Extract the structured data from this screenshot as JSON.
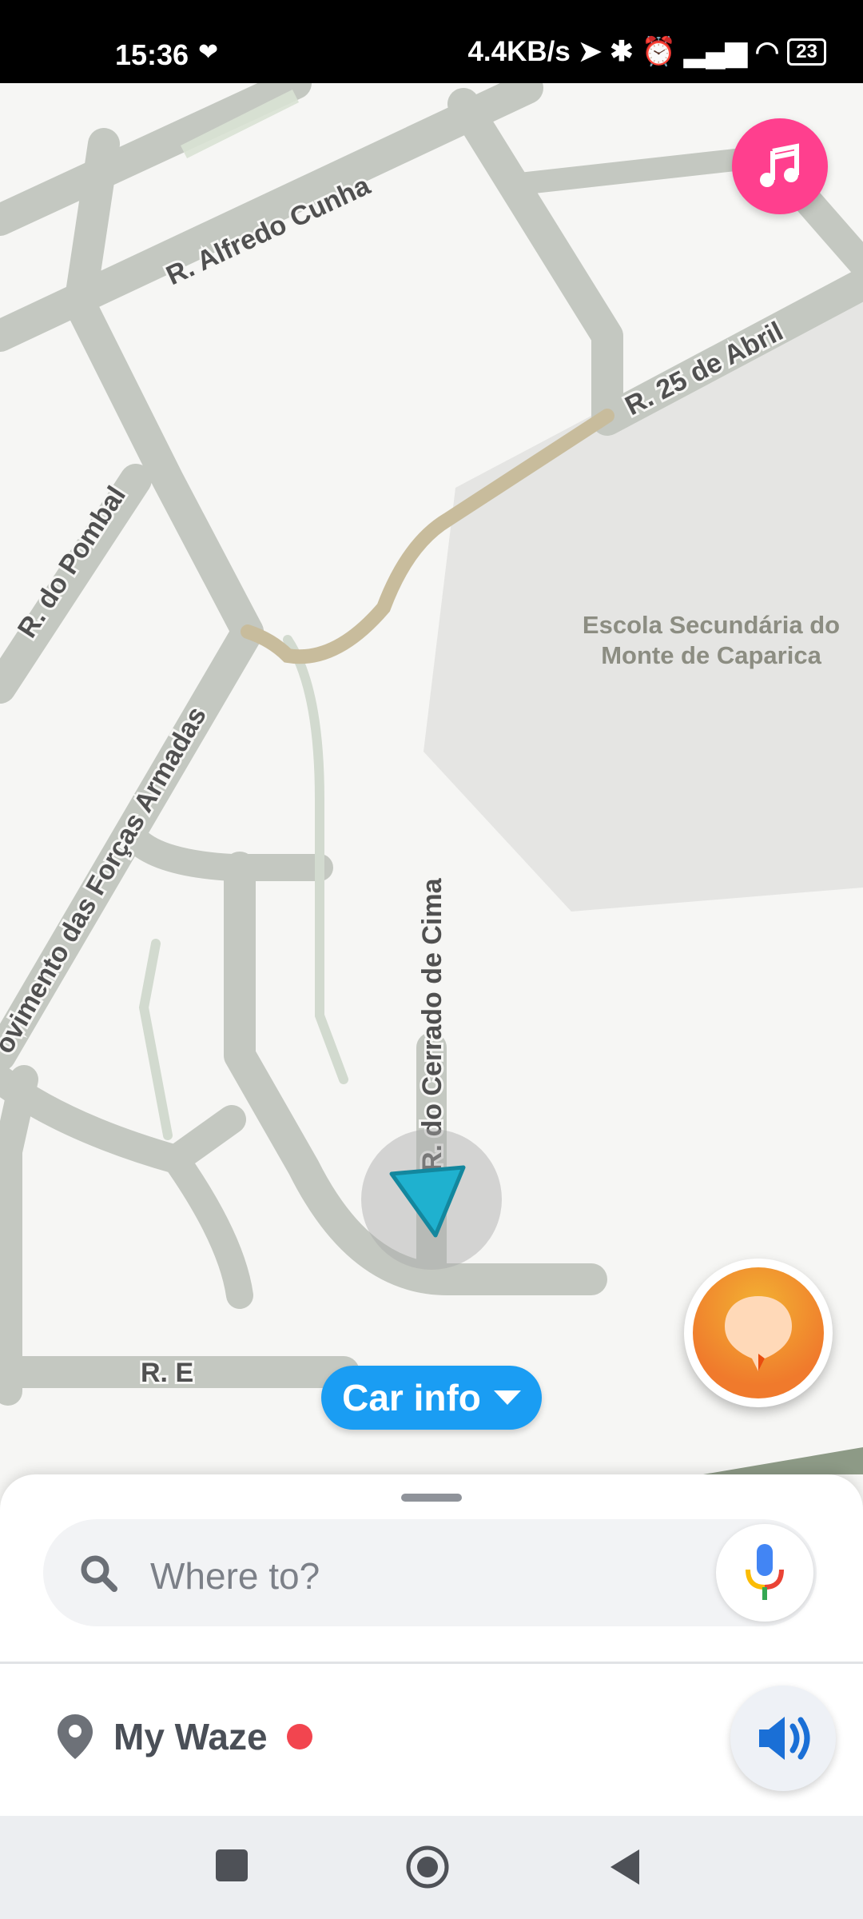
{
  "status_bar": {
    "time": "15:36",
    "network_speed": "4.4KB/s",
    "battery": "23"
  },
  "map": {
    "streets": {
      "alfredo_cunha": "R. Alfredo Cunha",
      "abril": "R. 25 de Abril",
      "pombal": "R. do Pombal",
      "forcas_armadas": "ovimento das Forças Armadas",
      "cerrado": "R. do Cerrado de Cima",
      "e": "R. E"
    },
    "poi_line1": "Escola Secundária do",
    "poi_line2": "Monte de Caparica"
  },
  "car_info": {
    "label": "Car info"
  },
  "search": {
    "placeholder": "Where to?"
  },
  "my_waze": {
    "label": "My Waze"
  },
  "icons": {
    "music": "music-note-icon",
    "report": "report-icon",
    "search": "search-icon",
    "mic": "microphone-icon",
    "location": "location-pin-icon",
    "sound": "sound-icon",
    "recents": "square-icon",
    "home": "home-circle-icon",
    "back": "back-triangle-icon"
  },
  "colors": {
    "accent": "#1a9df3",
    "music": "#ff3f8e",
    "report": "#f07a2c",
    "notification_dot": "#f2454f"
  }
}
